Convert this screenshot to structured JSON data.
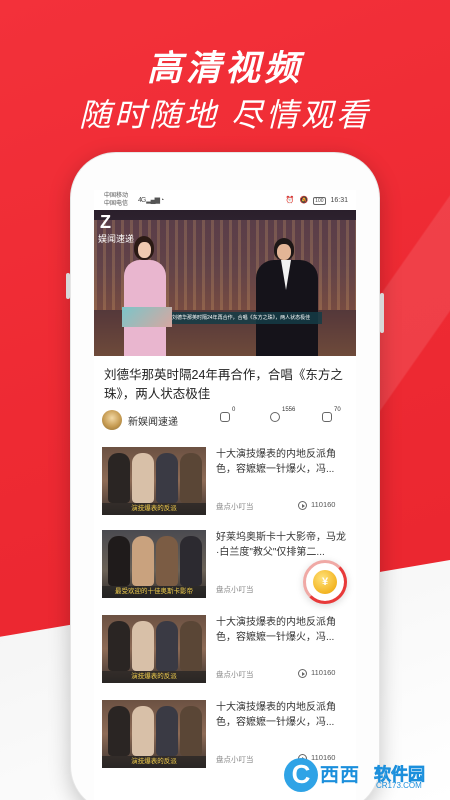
{
  "promo": {
    "headline": "高清视频",
    "subheadline": "随时随地 尽情观看"
  },
  "status_bar": {
    "carrier_1": "中国移动",
    "carrier_2": "中国电信",
    "network": "4G",
    "battery": "100",
    "time": "16:31"
  },
  "featured": {
    "logo_text": "娱闻速递",
    "video_caption": "刘德华那英时隔24年再合作，合唱《东方之珠》，两人状态极佳",
    "title": "刘德华那英时隔24年再合作，合唱《东方之珠》，两人状态极佳",
    "source": "新娱闻速递",
    "comments": "0",
    "plays": "1556",
    "likes": "70"
  },
  "list": [
    {
      "title": "十大演技爆表的内地反派角色，容嬷嬷一针爆火，冯...",
      "source": "盘点小叮当",
      "views": "110160",
      "thumb_caption": "演技爆表的反派"
    },
    {
      "title": "好莱坞奥斯卡十大影帝，马龙·白兰度\"教父\"仅排第二...",
      "source": "盘点小叮当",
      "views": "",
      "thumb_caption": "最受欢迎的十佳奥斯卡影帝"
    },
    {
      "title": "十大演技爆表的内地反派角色，容嬷嬷一针爆火，冯...",
      "source": "盘点小叮当",
      "views": "110160",
      "thumb_caption": "演技爆表的反派"
    },
    {
      "title": "十大演技爆表的内地反派角色，容嬷嬷一针爆火，冯...",
      "source": "盘点小叮当",
      "views": "110160",
      "thumb_caption": "演技爆表的反派"
    }
  ],
  "coin_symbol": "¥",
  "watermark": {
    "logo": "C",
    "name": "西西",
    "sub": "软件园",
    "url": "CR173.COM"
  },
  "colors": {
    "brand_red": "#ee2a33",
    "coin_gold": "#f3b523",
    "watermark_blue": "#1b8fdc"
  }
}
